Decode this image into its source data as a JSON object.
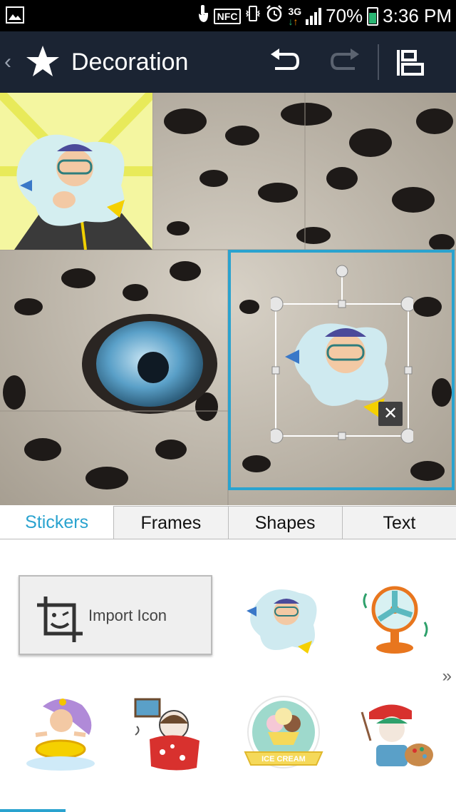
{
  "status_bar": {
    "network": "3G",
    "nfc_label": "NFC",
    "battery": "70%",
    "time": "3:36 PM",
    "icons": [
      "gallery-icon",
      "touch-icon",
      "nfc-icon",
      "vibrate-icon",
      "alarm-icon",
      "network-icon",
      "signal-icon",
      "battery-icon"
    ]
  },
  "action_bar": {
    "title": "Decoration",
    "icons": [
      "back-caret-icon",
      "star-icon",
      "undo-icon",
      "redo-icon",
      "layout-icon"
    ]
  },
  "canvas": {
    "stickers": [
      "diver-sticker",
      "diver-sticker-selected"
    ],
    "close_label": "✕"
  },
  "tabs": [
    "Stickers",
    "Frames",
    "Shapes",
    "Text"
  ],
  "active_tab": "Stickers",
  "sticker_panel": {
    "import_label": "Import Icon",
    "ice_cream_label": "ICE CREAM",
    "more_label": "»",
    "stickers": [
      "diver",
      "fan",
      "swim-girl",
      "cold-girl",
      "ice-cream",
      "painter-girl"
    ]
  },
  "colors": {
    "accent": "#2aa3cf",
    "action_bar": "#1b2433",
    "status_bar": "#000000"
  }
}
